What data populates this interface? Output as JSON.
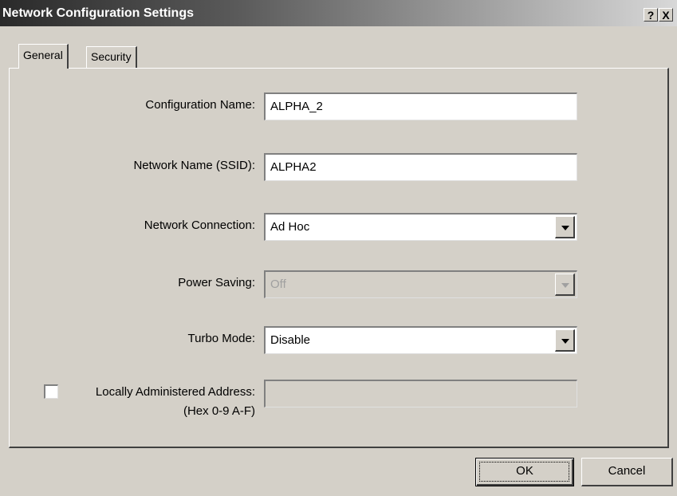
{
  "window": {
    "title": "Network Configuration Settings",
    "help_label": "?",
    "close_label": "X"
  },
  "tabs": [
    {
      "label": "General",
      "selected": true
    },
    {
      "label": "Security",
      "selected": false
    }
  ],
  "form": {
    "config_name": {
      "label": "Configuration Name:",
      "value": "ALPHA_2"
    },
    "ssid": {
      "label": "Network Name (SSID):",
      "value": "ALPHA2"
    },
    "connection": {
      "label": "Network Connection:",
      "value": "Ad Hoc"
    },
    "power_saving": {
      "label": "Power Saving:",
      "value": "Off",
      "enabled": false
    },
    "turbo_mode": {
      "label": "Turbo Mode:",
      "value": "Disable"
    },
    "laa": {
      "label": "Locally Administered Address:",
      "sublabel": "(Hex 0-9 A-F)",
      "checked": false,
      "value": ""
    }
  },
  "buttons": {
    "ok": "OK",
    "cancel": "Cancel"
  }
}
